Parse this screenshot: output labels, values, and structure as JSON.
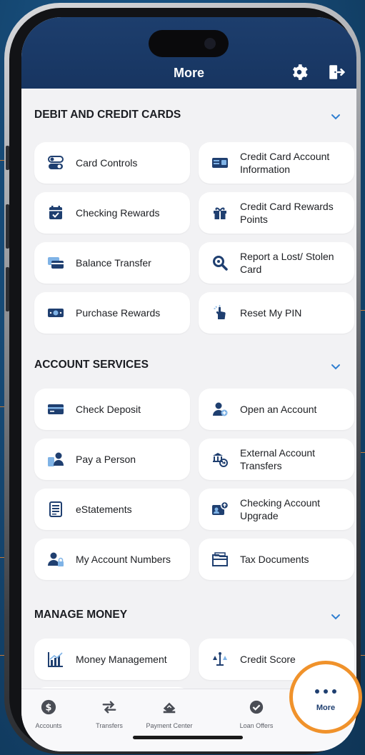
{
  "header": {
    "title": "More"
  },
  "sections": [
    {
      "title": "DEBIT AND CREDIT CARDS",
      "items": [
        {
          "label": "Card Controls",
          "icon": "toggle-switches-icon"
        },
        {
          "label": "Credit Card Account Information",
          "icon": "credit-card-info-icon"
        },
        {
          "label": "Checking Rewards",
          "icon": "calendar-check-icon"
        },
        {
          "label": "Credit Card Rewards Points",
          "icon": "gift-icon"
        },
        {
          "label": "Balance Transfer",
          "icon": "card-transfer-icon"
        },
        {
          "label": "Report a Lost/ Stolen Card",
          "icon": "magnifier-icon"
        },
        {
          "label": "Purchase Rewards",
          "icon": "money-bill-icon"
        },
        {
          "label": "Reset My PIN",
          "icon": "hand-tap-icon"
        }
      ]
    },
    {
      "title": "ACCOUNT SERVICES",
      "items": [
        {
          "label": "Check Deposit",
          "icon": "check-card-icon"
        },
        {
          "label": "Open an Account",
          "icon": "user-plus-icon"
        },
        {
          "label": "Pay a Person",
          "icon": "pay-person-icon"
        },
        {
          "label": "External Account Transfers",
          "icon": "bank-transfer-icon"
        },
        {
          "label": "eStatements",
          "icon": "document-icon"
        },
        {
          "label": "Checking Account Upgrade",
          "icon": "account-upgrade-icon"
        },
        {
          "label": "My Account Numbers",
          "icon": "user-lock-icon"
        },
        {
          "label": "Tax Documents",
          "icon": "folder-icon"
        }
      ]
    },
    {
      "title": "MANAGE MONEY",
      "items": [
        {
          "label": "Money Management",
          "icon": "chart-icon"
        },
        {
          "label": "Credit Score",
          "icon": "scale-icon"
        }
      ]
    }
  ],
  "tabs": [
    {
      "label": "Accounts",
      "icon": "dollar-circle-icon"
    },
    {
      "label": "Transfers",
      "icon": "transfer-arrows-icon"
    },
    {
      "label": "Payment Center",
      "icon": "payment-icon"
    },
    {
      "label": "Loan Offers",
      "icon": "badge-check-icon"
    },
    {
      "label": "More",
      "icon": "more-dots-icon",
      "active": true
    }
  ],
  "colors": {
    "brand_navy": "#1d3e6d",
    "accent_orange": "#f0922b",
    "chevron_blue": "#2f7fd1",
    "icon_navy": "#1f3f70",
    "callout_line": "#c97a37"
  }
}
